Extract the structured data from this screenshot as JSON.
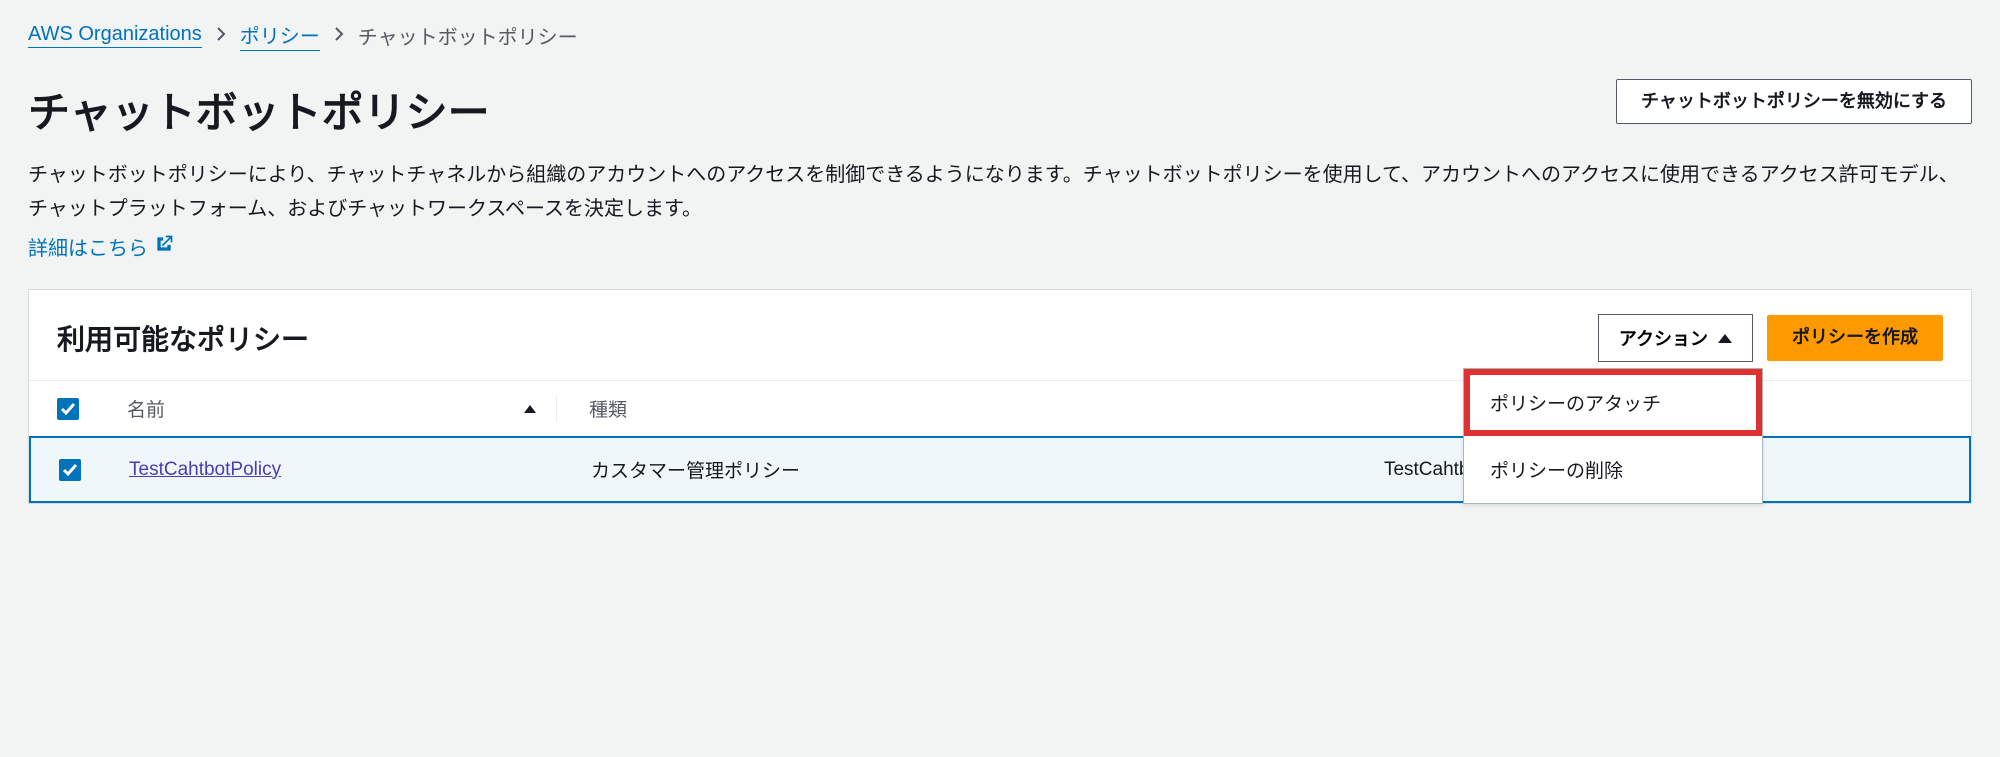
{
  "breadcrumb": {
    "root": "AWS Organizations",
    "mid": "ポリシー",
    "current": "チャットボットポリシー"
  },
  "header": {
    "title": "チャットボットポリシー",
    "disable_btn": "チャットボットポリシーを無効にする"
  },
  "description": {
    "text": "チャットボットポリシーにより、チャットチャネルから組織のアカウントへのアクセスを制御できるようになります。チャットボットポリシーを使用して、アカウントへのアクセスに使用できるアクセス許可モデル、チャットプラットフォーム、およびチャットワークスペースを決定します。",
    "learn_more": "詳細はこちら"
  },
  "panel": {
    "title": "利用可能なポリシー",
    "action_btn": "アクション",
    "create_btn": "ポリシーを作成",
    "dropdown": {
      "attach": "ポリシーのアタッチ",
      "delete": "ポリシーの削除"
    }
  },
  "table": {
    "headers": {
      "name": "名前",
      "type": "種類"
    },
    "rows": [
      {
        "name": "TestCahtbotPolicy",
        "type": "カスタマー管理ポリシー",
        "extra": "TestCahtbotPolicy"
      }
    ]
  }
}
